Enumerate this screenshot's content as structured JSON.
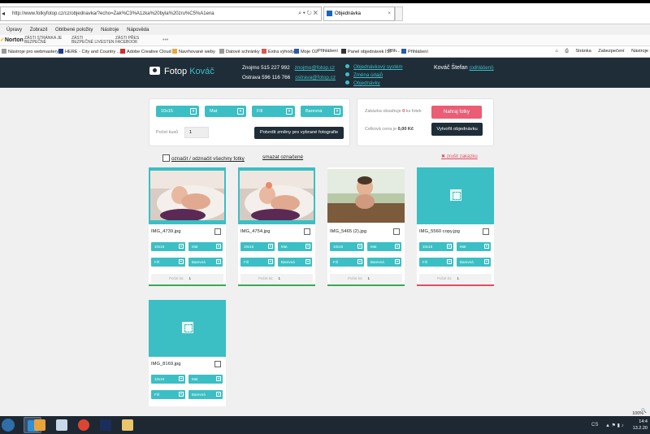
{
  "browser": {
    "url": "http://www.fotkyfotop.cz/cz/objednavka/?echo=Zak%C3%A1zka%20byla%20zru%C5%A1ena",
    "tab_title": "Objednávka",
    "menu": [
      "Úpravy",
      "Zobrazit",
      "Oblíbené položky",
      "Nástroje",
      "Nápověda"
    ],
    "norton": {
      "logo": "Norton",
      "items": [
        {
          "line1": "ZÁSTI STRÁNKA JE",
          "line2": "BEZPEČNÉ"
        },
        {
          "line1": "ZÁSTI",
          "line2": "BEZPEČNÉ LIVESTEN"
        },
        {
          "line1": "ZÁSTI PŘES",
          "line2": "FACEBOOK"
        }
      ],
      "dots": "•••"
    },
    "favorites": [
      "Nástroje pro webmastery ...",
      "HERE - City and Country ...",
      "Adobe Creative Cloud",
      "Navrhované weby",
      "Datové schránky",
      "Extra výhody",
      "Moje O2",
      "Přihlášení",
      "Panel objednávek ISF",
      "Přih...",
      "Přihlášení"
    ],
    "tools": [
      "Stránka",
      "Zabezpečení",
      "Nástroje"
    ],
    "zoom": "100%"
  },
  "site": {
    "logo_main": "Fotop",
    "logo_accent": "Kováč",
    "contact": [
      {
        "label": "Znojmo 515 227 992",
        "email": "znojmo@fotop.cz"
      },
      {
        "label": "Ostrava 596 116 766",
        "email": "ostrava@fotop.cz"
      }
    ],
    "header_links": [
      "Objednávkový systém",
      "Změna údajů",
      "Objednávky"
    ],
    "user": "Kováč Štefan",
    "logout": "(odhlášení)"
  },
  "bulk_panel": {
    "selects": [
      "10x15",
      "Mat",
      "Fill",
      "Barevná"
    ],
    "qty_label": "Počet kusů",
    "qty_value": "1",
    "confirm_button": "Potvrdit změny pro vybrané fotografie"
  },
  "summary_panel": {
    "line1_prefix": "Zakázka obsahuje",
    "line1_count": "0",
    "line1_suffix": "ks fotek",
    "line2_prefix": "Celková cena je",
    "line2_value": "0,00 Kč",
    "upload_button": "Nahraj fotky",
    "create_button": "Vytvořit objednávku"
  },
  "actions": {
    "select_all": "označit / odznačit všechny fotky",
    "delete_selected": "smazat označené",
    "cancel_order": "zrušit zakázku"
  },
  "photos": [
    {
      "name": "IMG_4739.jpg",
      "size": "10x15",
      "paper": "Mat",
      "fit": "Fill",
      "color": "Barevná",
      "qty_label": "Počet ks:",
      "qty": "1",
      "status_color": "#35a853"
    },
    {
      "name": "IMG_4754.jpg",
      "size": "10x15",
      "paper": "Mat",
      "fit": "Fill",
      "color": "Barevná",
      "qty_label": "Počet ks:",
      "qty": "1",
      "status_color": "#35a853"
    },
    {
      "name": "IMG_5465 (2).jpg",
      "size": "10x15",
      "paper": "Mat",
      "fit": "Fill",
      "color": "Barevná",
      "qty_label": "Počet ks:",
      "qty": "1",
      "status_color": "#35a853"
    },
    {
      "name": "IMG_5560 copy.jpg",
      "size": "10x15",
      "paper": "Mat",
      "fit": "Fill",
      "color": "Barevná",
      "qty_label": "Počet ks:",
      "qty": "1",
      "status_color": "#e24a5f"
    },
    {
      "name": "IMG_8169.jpg",
      "size": "10x15",
      "paper": "Mat",
      "fit": "Fill",
      "color": "Barevná",
      "qty_label": "Počet ks:",
      "qty": "1",
      "status_color": ""
    }
  ],
  "taskbar": {
    "lang": "CS",
    "time": "14:4",
    "date": "13.2.20"
  },
  "colors": {
    "accent": "#3bbfc4",
    "header_bg": "#1f2d38",
    "upload_button": "#ea5d74"
  }
}
